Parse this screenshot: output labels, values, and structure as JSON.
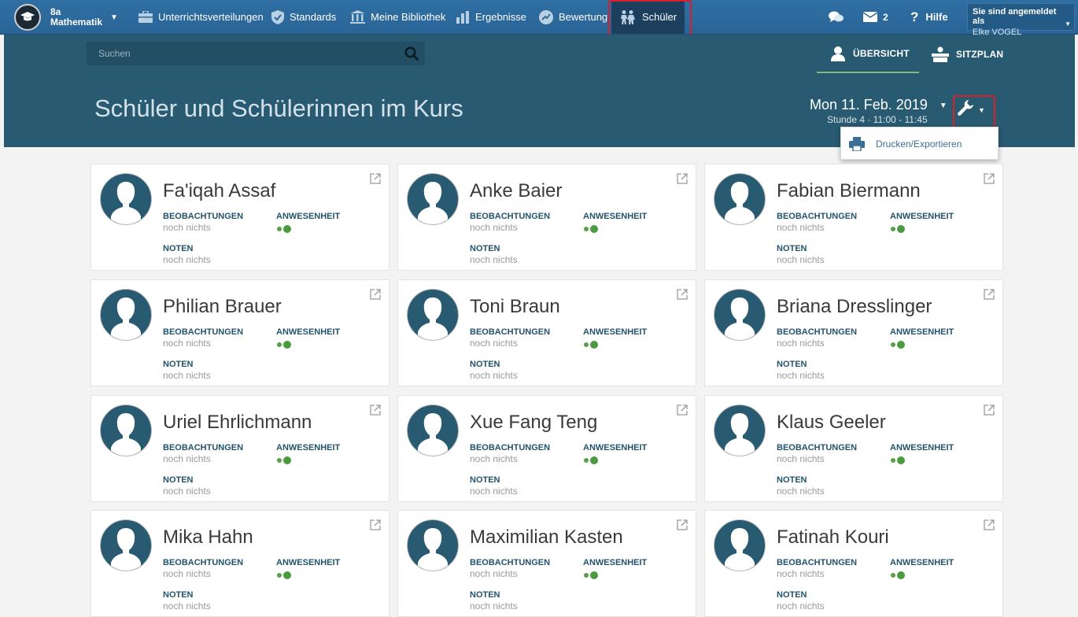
{
  "course": {
    "class": "8a",
    "subject": "Mathematik"
  },
  "nav": {
    "items": [
      {
        "label": "Unterrichtsverteilungen",
        "icon": "briefcase-icon"
      },
      {
        "label": "Standards",
        "icon": "shield-icon"
      },
      {
        "label": "Meine Bibliothek",
        "icon": "library-icon"
      },
      {
        "label": "Ergebnisse",
        "icon": "bar-chart-icon"
      },
      {
        "label": "Bewertung",
        "icon": "rating-icon"
      },
      {
        "label": "Schüler",
        "icon": "students-icon",
        "active": true
      }
    ],
    "messages_count": "2",
    "help": "Hilfe"
  },
  "user": {
    "logged_in_as": "Sie sind angemeldet als",
    "name": "Elke VOGEL"
  },
  "search": {
    "placeholder": "Suchen"
  },
  "view_tabs": {
    "overview": "ÜBERSICHT",
    "seating": "SITZPLAN"
  },
  "page": {
    "title": "Schüler und Schülerinnen im Kurs"
  },
  "lesson": {
    "date": "Mon 11. Feb. 2019",
    "time": "Stunde 4 · 11:00 - 11:45"
  },
  "tools_menu": {
    "print_export": "Drucken/Exportieren"
  },
  "labels": {
    "observations": "BEOBACHTUNGEN",
    "attendance": "ANWESENHEIT",
    "grades": "NOTEN",
    "none": "noch nichts"
  },
  "students": [
    {
      "name": "Fa'iqah Assaf"
    },
    {
      "name": "Anke Baier"
    },
    {
      "name": "Fabian Biermann"
    },
    {
      "name": "Philian Brauer"
    },
    {
      "name": "Toni Braun"
    },
    {
      "name": "Briana Dresslinger"
    },
    {
      "name": "Uriel Ehrlichmann"
    },
    {
      "name": "Xue Fang Teng"
    },
    {
      "name": "Klaus Geeler"
    },
    {
      "name": "Mika Hahn"
    },
    {
      "name": "Maximilian Kasten"
    },
    {
      "name": "Fatinah Kouri"
    }
  ],
  "colors": {
    "nav": "#2a6496",
    "band": "#285a71",
    "accent": "#7cc07c",
    "attendance": "#4a9a3e",
    "highlight": "#d9202a"
  }
}
